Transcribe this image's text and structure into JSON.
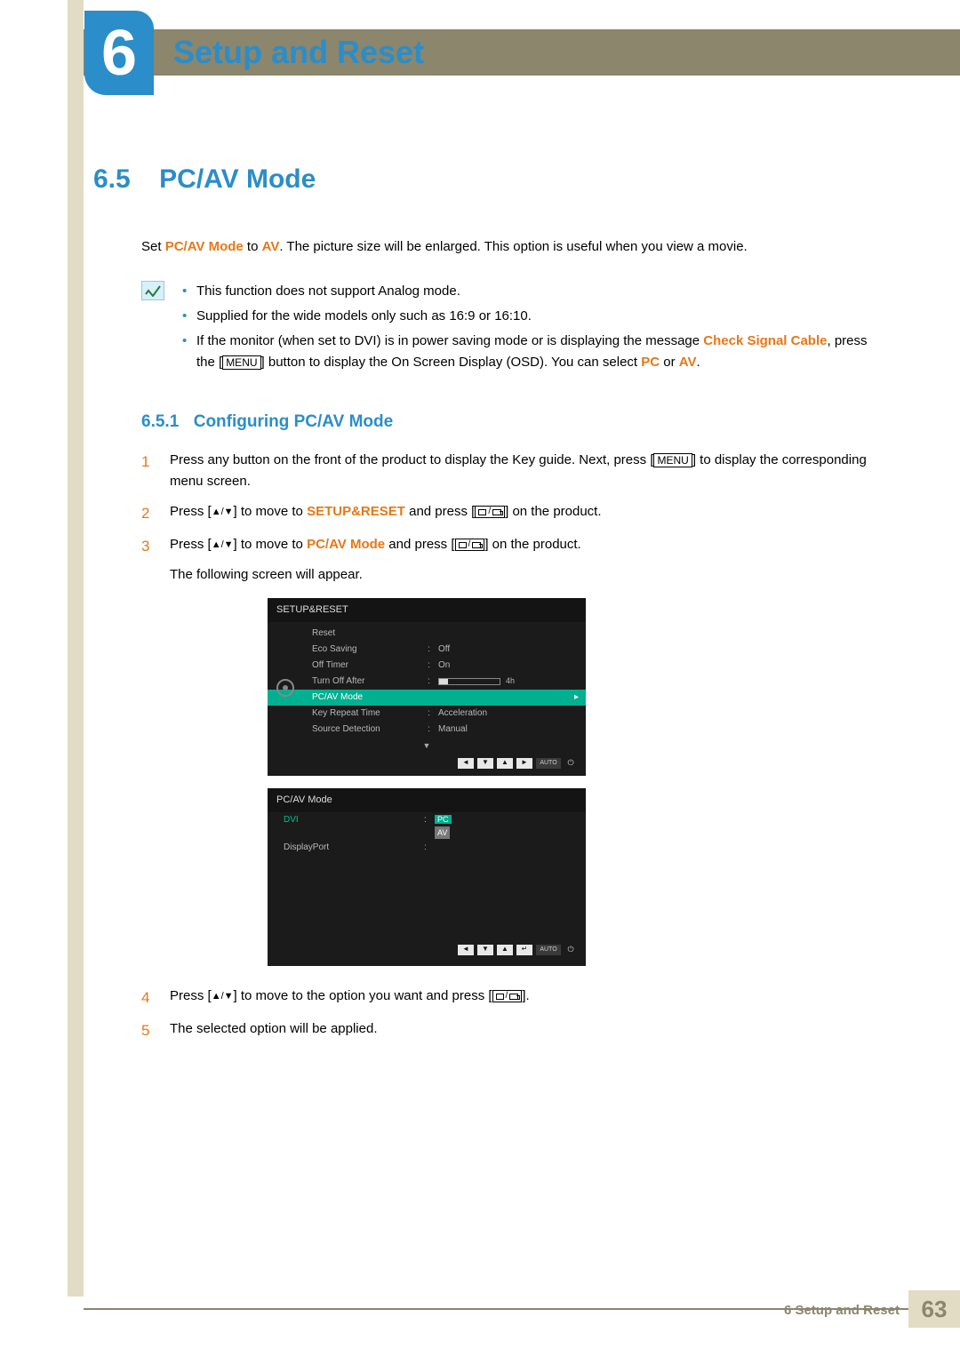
{
  "chapter": {
    "number": "6",
    "title": "Setup and Reset"
  },
  "section": {
    "number": "6.5",
    "title": "PC/AV Mode"
  },
  "intro": {
    "pre": "Set ",
    "k1": "PC/AV Mode",
    "mid1": " to ",
    "k2": "AV",
    "post": ". The picture size will be enlarged. This option is useful when you view a movie."
  },
  "note_bullets": {
    "b1": "This function does not support Analog mode.",
    "b2": "Supplied for the wide models only such as 16:9 or 16:10.",
    "b3a": "If the monitor (when set to DVI) is in power saving mode or is displaying the message ",
    "b3_check": "Check Signal Cable",
    "b3b": ", press the [",
    "b3_menu": "MENU",
    "b3c": "] button to display the On Screen Display (OSD). You can select ",
    "b3_pc": "PC",
    "b3d": " or ",
    "b3_av": "AV",
    "b3e": "."
  },
  "subsection": {
    "number": "6.5.1",
    "title": "Configuring PC/AV Mode"
  },
  "steps": {
    "s1a": "Press any button on the front of the product to display the Key guide. Next, press [",
    "s1_menu": "MENU",
    "s1b": "] to display the corresponding menu screen.",
    "s2a": "Press [",
    "s2b": "] to move to ",
    "s2_k": "SETUP&RESET",
    "s2c": " and press [",
    "s2d": "] on the product.",
    "s3a": "Press [",
    "s3b": "] to move to ",
    "s3_k": "PC/AV Mode",
    "s3c": " and press [",
    "s3d": "] on the product.",
    "s3e": "The following screen will appear.",
    "s4a": "Press [",
    "s4b": "] to move to the option you want and press [",
    "s4c": "].",
    "s5": "The selected option will be applied."
  },
  "osd1": {
    "title": "SETUP&RESET",
    "rows": [
      {
        "label": "Reset",
        "value": ""
      },
      {
        "label": "Eco Saving",
        "value": "Off"
      },
      {
        "label": "Off Timer",
        "value": "On"
      },
      {
        "label": "Turn Off After",
        "value": "",
        "slider": "4h"
      },
      {
        "label": "PC/AV Mode",
        "value": "",
        "selected": true,
        "arrow": true
      },
      {
        "label": "Key Repeat Time",
        "value": "Acceleration"
      },
      {
        "label": "Source Detection",
        "value": "Manual"
      }
    ],
    "nav_auto": "AUTO"
  },
  "osd2": {
    "title": "PC/AV Mode",
    "rows": [
      {
        "label": "DVI",
        "green": true,
        "opts": [
          "PC",
          "AV"
        ],
        "sel": 0
      },
      {
        "label": "DisplayPort"
      }
    ],
    "nav_auto": "AUTO"
  },
  "footer": {
    "text": "6 Setup and Reset",
    "page": "63"
  }
}
